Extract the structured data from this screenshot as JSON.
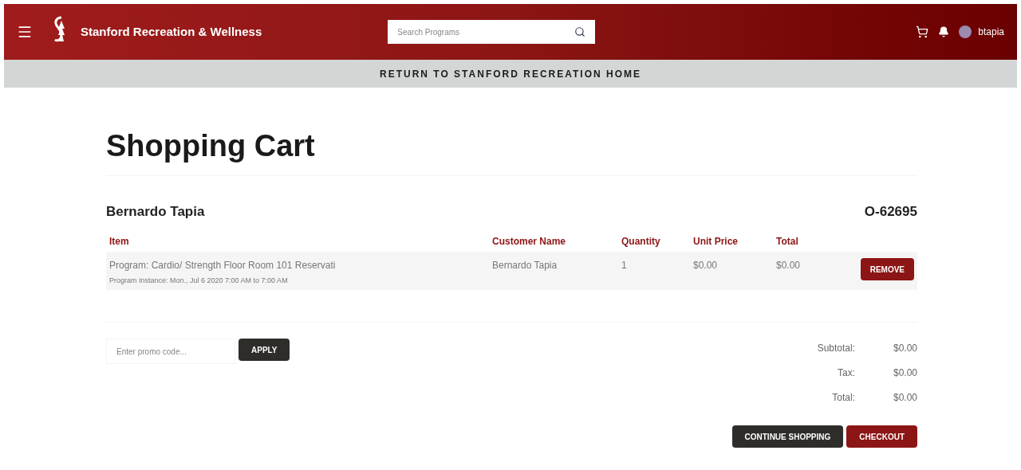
{
  "header": {
    "brand": "Stanford Recreation & Wellness",
    "search": {
      "placeholder": "Search Programs"
    },
    "user": "btapia"
  },
  "return_link": "RETURN TO STANFORD RECREATION HOME",
  "title": "Shopping Cart",
  "customer": "Bernardo Tapia",
  "order_number": "O-62695",
  "table": {
    "columns": [
      "Item",
      "Customer Name",
      "Quantity",
      "Unit Price",
      "Total"
    ],
    "rows": [
      {
        "item": "Program: Cardio/ Strength Floor Room 101 Reservati",
        "detail": "Program Instance: Mon., Jul 6 2020 7:00 AM to 7:00 AM",
        "customer_name": "Bernardo Tapia",
        "quantity": "1",
        "unit_price": "$0.00",
        "total": "$0.00",
        "action": "REMOVE"
      }
    ]
  },
  "promo": {
    "placeholder": "Enter promo code...",
    "button": "APPLY"
  },
  "summary": [
    {
      "label": "Subtotal:",
      "value": "$0.00"
    },
    {
      "label": "Tax:",
      "value": "$0.00"
    },
    {
      "label": "Total:",
      "value": "$0.00"
    }
  ],
  "buttons": [
    {
      "label": "CONTINUE SHOPPING",
      "kind": "secondary"
    },
    {
      "label": "CHECKOUT",
      "kind": "primary"
    }
  ]
}
